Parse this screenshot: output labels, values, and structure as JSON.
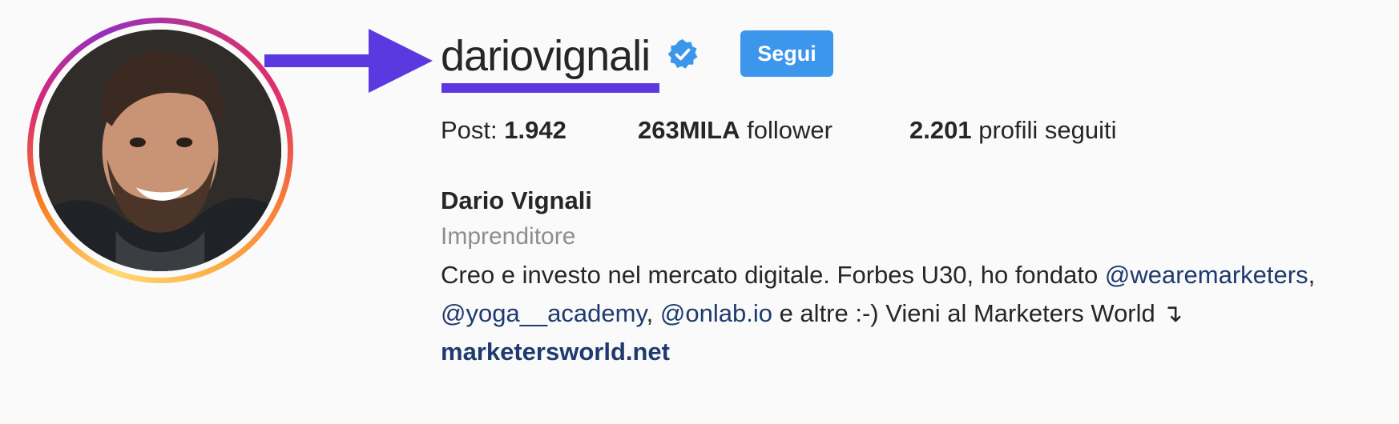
{
  "profile": {
    "username": "dariovignali",
    "verified": true,
    "follow_label": "Segui",
    "stats": {
      "posts_label": "Post:",
      "posts_value": "1.942",
      "followers_value": "263MILA",
      "followers_label": "follower",
      "following_value": "2.201",
      "following_label": "profili seguiti"
    },
    "full_name": "Dario Vignali",
    "category": "Imprenditore",
    "bio": {
      "line1_text": "Creo e investo nel mercato digitale. Forbes U30, ho fondato ",
      "mention1": "@wearemarketers",
      "line1_end": ",",
      "mention2": "@yoga__academy",
      "sep": ", ",
      "mention3": "@onlab.io",
      "line2_text": " e altre :-) Vieni al Marketers World ↴",
      "website": "marketersworld.net"
    }
  },
  "colors": {
    "follow_button": "#3c96ec",
    "verified_badge": "#3c96ec",
    "annotation": "#5b38e0",
    "link": "#1e3a6e",
    "category": "#8e8e8e"
  },
  "icons": {
    "verified": "verified-badge-icon",
    "annotation_arrow": "arrow-right-icon"
  }
}
